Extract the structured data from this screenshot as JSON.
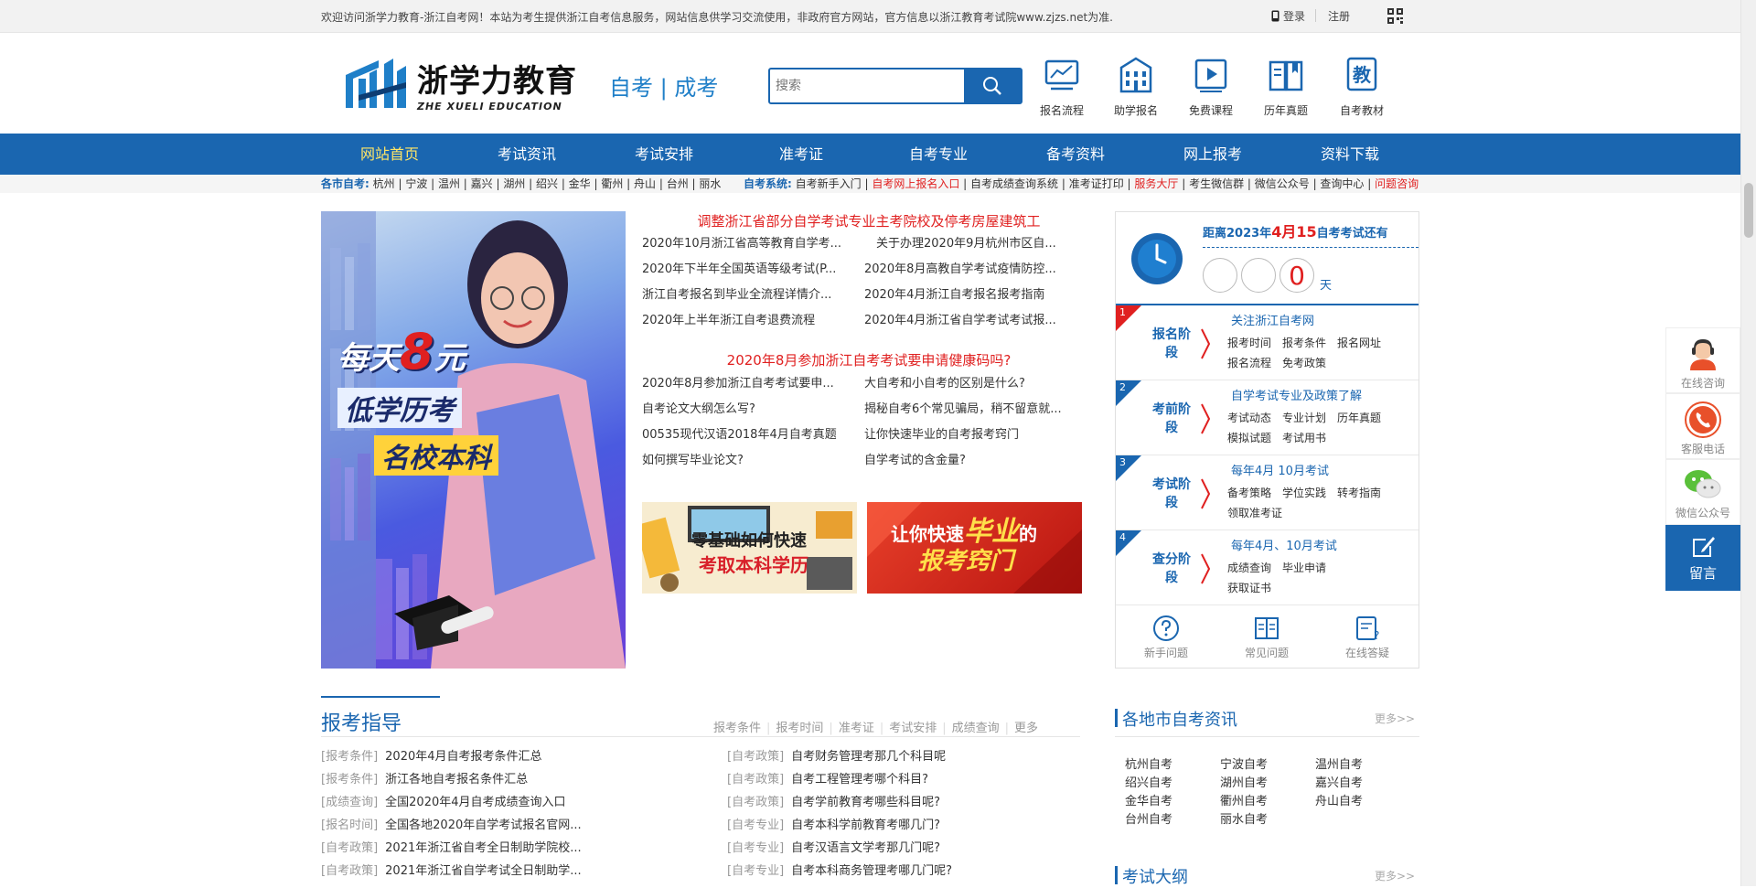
{
  "topbar": {
    "welcome": "欢迎访问浙学力教育-浙江自考网！本站为考生提供浙江自考信息服务，网站信息供学习交流使用，非政府官方网站，官方信息以浙江教育考试院www.zjzs.net为准.",
    "login": "登录",
    "register": "注册"
  },
  "header": {
    "logo_cn": "浙学力教育",
    "logo_en": "ZHE XUELI EDUCATION",
    "tagline": "自考 | 成考",
    "search_placeholder": "搜索",
    "quick": [
      {
        "label": "报名流程",
        "icon": "chart-board-icon"
      },
      {
        "label": "助学报名",
        "icon": "school-building-icon"
      },
      {
        "label": "免费课程",
        "icon": "video-play-icon"
      },
      {
        "label": "历年真题",
        "icon": "open-book-icon"
      },
      {
        "label": "自考教材",
        "icon": "textbook-icon"
      }
    ]
  },
  "nav": [
    "网站首页",
    "考试资讯",
    "考试安排",
    "准考证",
    "自考专业",
    "备考资料",
    "网上报考",
    "资料下载"
  ],
  "subnav": {
    "city_label": "各市自考:",
    "cities": "杭州 | 宁波 | 温州 | 嘉兴 | 湖州 | 绍兴 | 金华 | 衢州 | 舟山 | 台州 | 丽水",
    "sys_label": "自考系统:",
    "sys1": "自考新手入门 |",
    "sys2": "自考网上报名入口",
    "sys3": "| 自考成绩查询系统 | 准考证打印 |",
    "sys4": "服务大厅",
    "sys5": "| 考生微信群 | 微信公众号 | 查询中心 |",
    "sys6": "问题咨询"
  },
  "banner": {
    "line1": "每天",
    "num": "8",
    "unit": "元",
    "line2": "低学历考",
    "line3": "名校本科"
  },
  "news": {
    "headline1": "调整浙江省部分自学考试专业主考院校及停考房屋建筑工",
    "list1": [
      "2020年10月浙江省高等教育自学考...",
      "关于办理2020年9月杭州市区自...",
      "2020年下半年全国英语等级考试(P...",
      "2020年8月高教自学考试疫情防控...",
      "浙江自考报名到毕业全流程详情介...",
      "2020年4月浙江自考报名报考指南",
      "2020年上半年浙江自考退费流程",
      "2020年4月浙江省自学考试考试报..."
    ],
    "headline2": "2020年8月参加浙江自考考试要申请健康码吗?",
    "list2": [
      "2020年8月参加浙江自考考试要申...",
      "大自考和小自考的区别是什么?",
      "自考论文大纲怎么写?",
      "揭秘自考6个常见骗局，稍不留意就...",
      "00535现代汉语2018年4月自考真题",
      "让你快速毕业的自考报考窍门",
      "如何撰写毕业论文?",
      "自学考试的含金量?"
    ],
    "ad1_line1": "零基础如何快速",
    "ad1_line2": "考取本科学历",
    "ad2_line1": "让你快速",
    "ad2_big": "毕业",
    "ad2_tail": "的",
    "ad2_line2": "报考窍门"
  },
  "countdown": {
    "prefix": "距离2023年",
    "date": "4月15",
    "suffix": "自考考试还有",
    "digits": [
      "",
      "",
      "0"
    ],
    "unit": "天"
  },
  "stages": [
    {
      "num": "1",
      "name": "报名阶段",
      "title": "关注浙江自考网",
      "links": [
        "报考时间",
        "报考条件",
        "报名网址",
        "报名流程",
        "免考政策"
      ]
    },
    {
      "num": "2",
      "name": "考前阶段",
      "title": "自学考试专业及政策了解",
      "links": [
        "考试动态",
        "专业计划",
        "历年真题",
        "模拟试题",
        "考试用书"
      ]
    },
    {
      "num": "3",
      "name": "考试阶段",
      "title": "每年4月 10月考试",
      "links": [
        "备考策略",
        "学位实践",
        "转考指南",
        "领取准考证"
      ]
    },
    {
      "num": "4",
      "name": "查分阶段",
      "title": "每年4月、10月考试",
      "links": [
        "成绩查询",
        "毕业申请",
        "获取证书"
      ]
    }
  ],
  "help": [
    "新手问题",
    "常见问题",
    "在线答疑"
  ],
  "guide": {
    "title": "报考指导",
    "tabs": [
      "报考条件",
      "报考时间",
      "准考证",
      "考试安排",
      "成绩查询",
      "更多"
    ],
    "left": [
      {
        "tag": "[报考条件]",
        "text": "2020年4月自考报考条件汇总"
      },
      {
        "tag": "[报考条件]",
        "text": "浙江各地自考报名条件汇总"
      },
      {
        "tag": "[成绩查询]",
        "text": "全国2020年4月自考成绩查询入口"
      },
      {
        "tag": "[报名时间]",
        "text": "全国各地2020年自学考试报名官网..."
      },
      {
        "tag": "[自考政策]",
        "text": "2021年浙江省自考全日制助学院校..."
      },
      {
        "tag": "[自考政策]",
        "text": "2021年浙江省自学考试全日制助学..."
      }
    ],
    "right": [
      {
        "tag": "[自考政策]",
        "text": "自考财务管理考那几个科目呢"
      },
      {
        "tag": "[自考政策]",
        "text": "自考工程管理考哪个科目?"
      },
      {
        "tag": "[自考政策]",
        "text": "自考学前教育考哪些科目呢?"
      },
      {
        "tag": "[自考专业]",
        "text": "自考本科学前教育考哪几门?"
      },
      {
        "tag": "[自考专业]",
        "text": "自考汉语言文学考那几门呢?"
      },
      {
        "tag": "[自考专业]",
        "text": "自考本科商务管理考哪几门呢?"
      }
    ]
  },
  "city_news": {
    "title": "各地市自考资讯",
    "more": "更多>>",
    "cities": [
      "杭州自考",
      "宁波自考",
      "温州自考",
      "绍兴自考",
      "湖州自考",
      "嘉兴自考",
      "金华自考",
      "衢州自考",
      "舟山自考",
      "台州自考",
      "丽水自考"
    ]
  },
  "outline": {
    "title": "考试大纲",
    "more": "更多>>"
  },
  "float": [
    "在线咨询",
    "客服电话",
    "微信公众号",
    "留言"
  ],
  "colors": {
    "brand": "#1a66b0",
    "accent_red": "#e02020",
    "nav_active": "#ffe566"
  }
}
